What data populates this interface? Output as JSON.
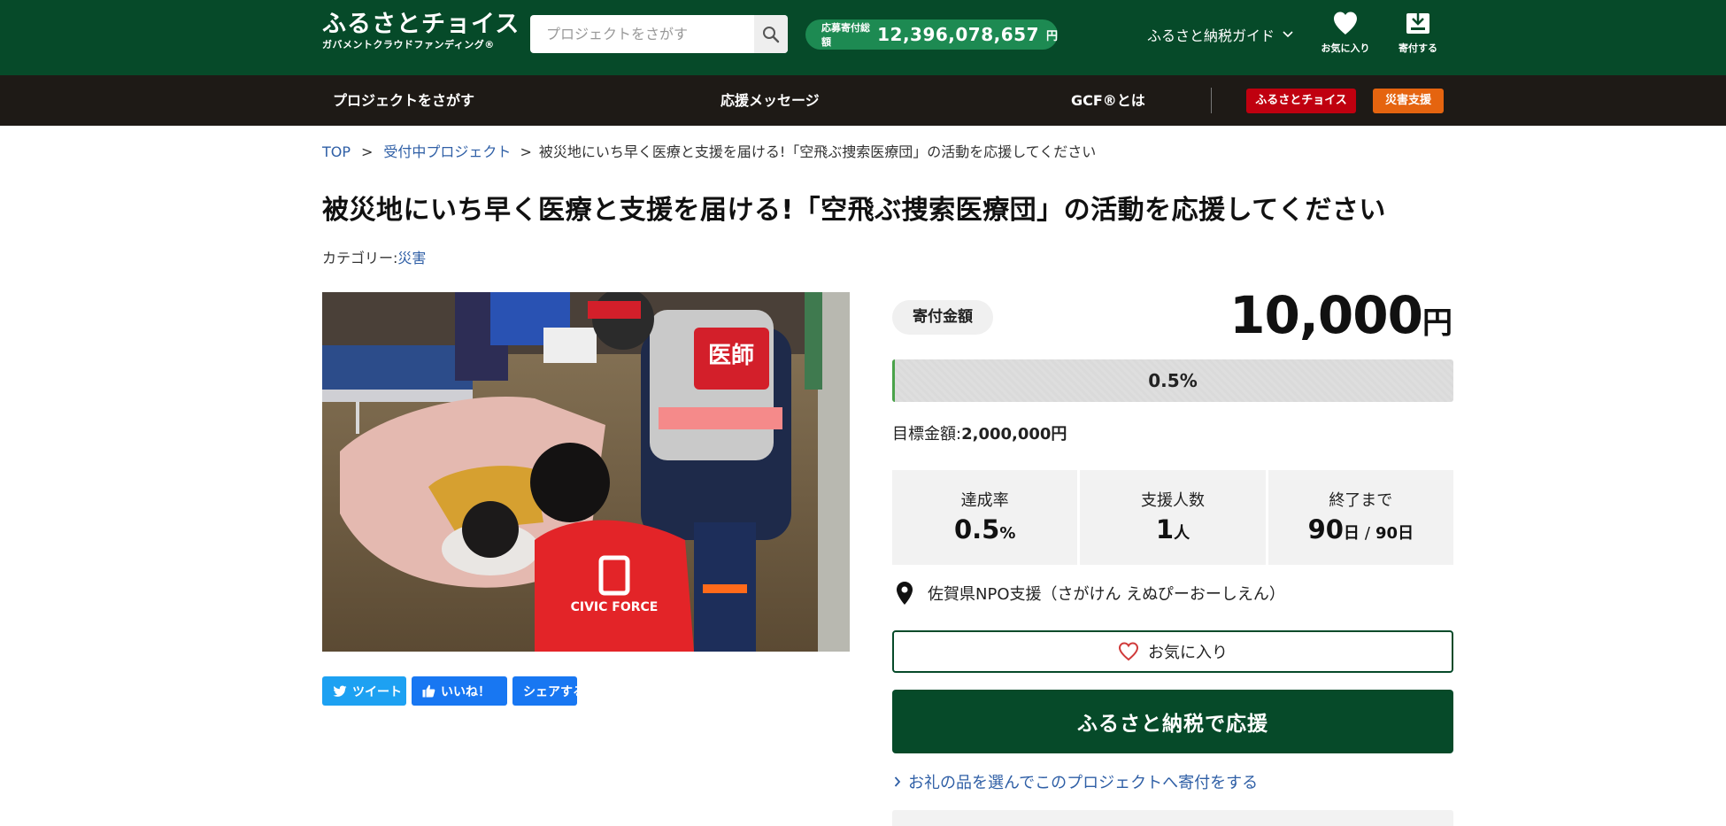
{
  "header": {
    "logo_main": "ふるさとチョイス",
    "logo_sub": "ガバメントクラウドファンディング®",
    "search_placeholder": "プロジェクトをさがす",
    "total_label": "応募寄付総額",
    "total_value": "12,396,078,657",
    "total_unit": "円",
    "guide_label": "ふるさと納税ガイド",
    "favorites_label": "お気に入り",
    "donate_label": "寄付する"
  },
  "nav": {
    "items": [
      "プロジェクトをさがす",
      "応援メッセージ",
      "GCF®とは"
    ],
    "badge_choice": "ふるさとチョイス",
    "badge_disaster": "災害支援"
  },
  "breadcrumb": {
    "top": "TOP",
    "sep": ">",
    "projects": "受付中プロジェクト",
    "current": "被災地にいち早く医療と支援を届ける!「空飛ぶ捜索医療団」の活動を応援してください"
  },
  "project": {
    "title": "被災地にいち早く医療と支援を届ける!「空飛ぶ捜索医療団」の活動を応援してください",
    "category_label": "カテゴリー:",
    "category_value": "災害"
  },
  "share": {
    "tweet": "ツイート",
    "like": "いいね！",
    "share": "シェアする"
  },
  "donation": {
    "amount_label": "寄付金額",
    "amount_value": "10,000",
    "amount_unit": "円",
    "progress_text": "0.5%",
    "progress_fraction": 0.005,
    "goal_label": "目標金額:",
    "goal_value": "2,000,000円"
  },
  "stats": {
    "rate_label": "達成率",
    "rate_value": "0.5",
    "rate_unit": "%",
    "supporters_label": "支援人数",
    "supporters_value": "1",
    "supporters_unit": "人",
    "remaining_label": "終了まで",
    "remaining_value": "90",
    "remaining_unit": "日",
    "remaining_sep": "/",
    "total_days": "90",
    "total_days_unit": "日"
  },
  "org": {
    "name": "佐賀県NPO支援（さがけん えぬぴーおーしえん）"
  },
  "actions": {
    "favorite": "お気に入り",
    "donate": "ふるさと納税で応援",
    "gift_link": "お礼の品を選んでこのプロジェクトへ寄付をする"
  },
  "colors": {
    "header_green": "#064a29",
    "nav_dark": "#1e1a16",
    "total_pill": "#1d8a52",
    "badge_red": "#c0000f",
    "badge_orange": "#e5640f",
    "link_blue": "#2f5fa6",
    "twitter": "#1da1f2",
    "facebook": "#1877f2"
  },
  "icons": {
    "search": "search-icon",
    "chevron": "chevron-down-icon",
    "heart": "heart-icon",
    "gift": "gift-icon",
    "pin": "map-pin-icon",
    "twitter": "twitter-icon",
    "thumbs_up": "thumbs-up-icon"
  }
}
